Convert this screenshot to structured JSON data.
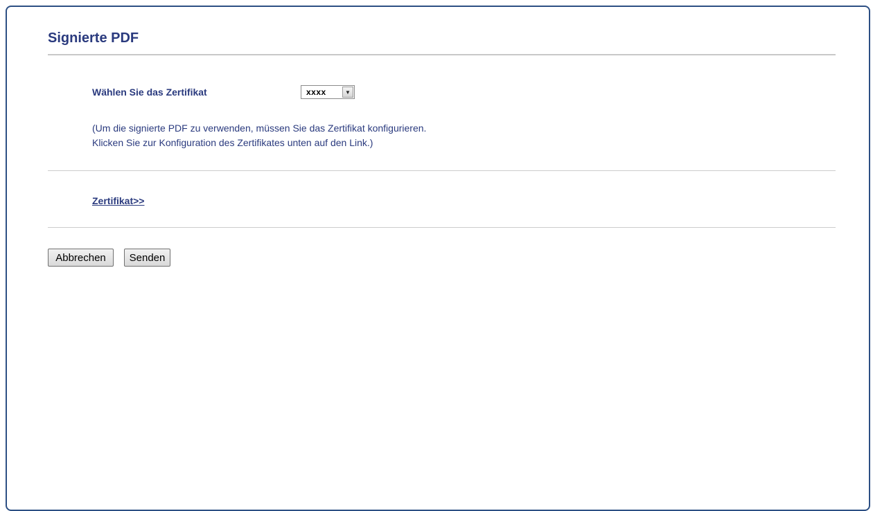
{
  "page": {
    "title": "Signierte PDF"
  },
  "certificate": {
    "label": "Wählen Sie das Zertifikat",
    "selected_value": "xxxx",
    "arrow_icon": "chevron-down-icon"
  },
  "hint": {
    "line1": "(Um die signierte PDF zu verwenden, müssen Sie das Zertifikat konfigurieren.",
    "line2": "Klicken Sie zur Konfiguration des Zertifikates unten auf den Link.)"
  },
  "link": {
    "label": "Zertifikat>>"
  },
  "buttons": {
    "cancel_label": "Abbrechen",
    "send_label": "Senden"
  },
  "colors": {
    "title": "#2a3a7e",
    "frame_border": "#2c4f83"
  }
}
